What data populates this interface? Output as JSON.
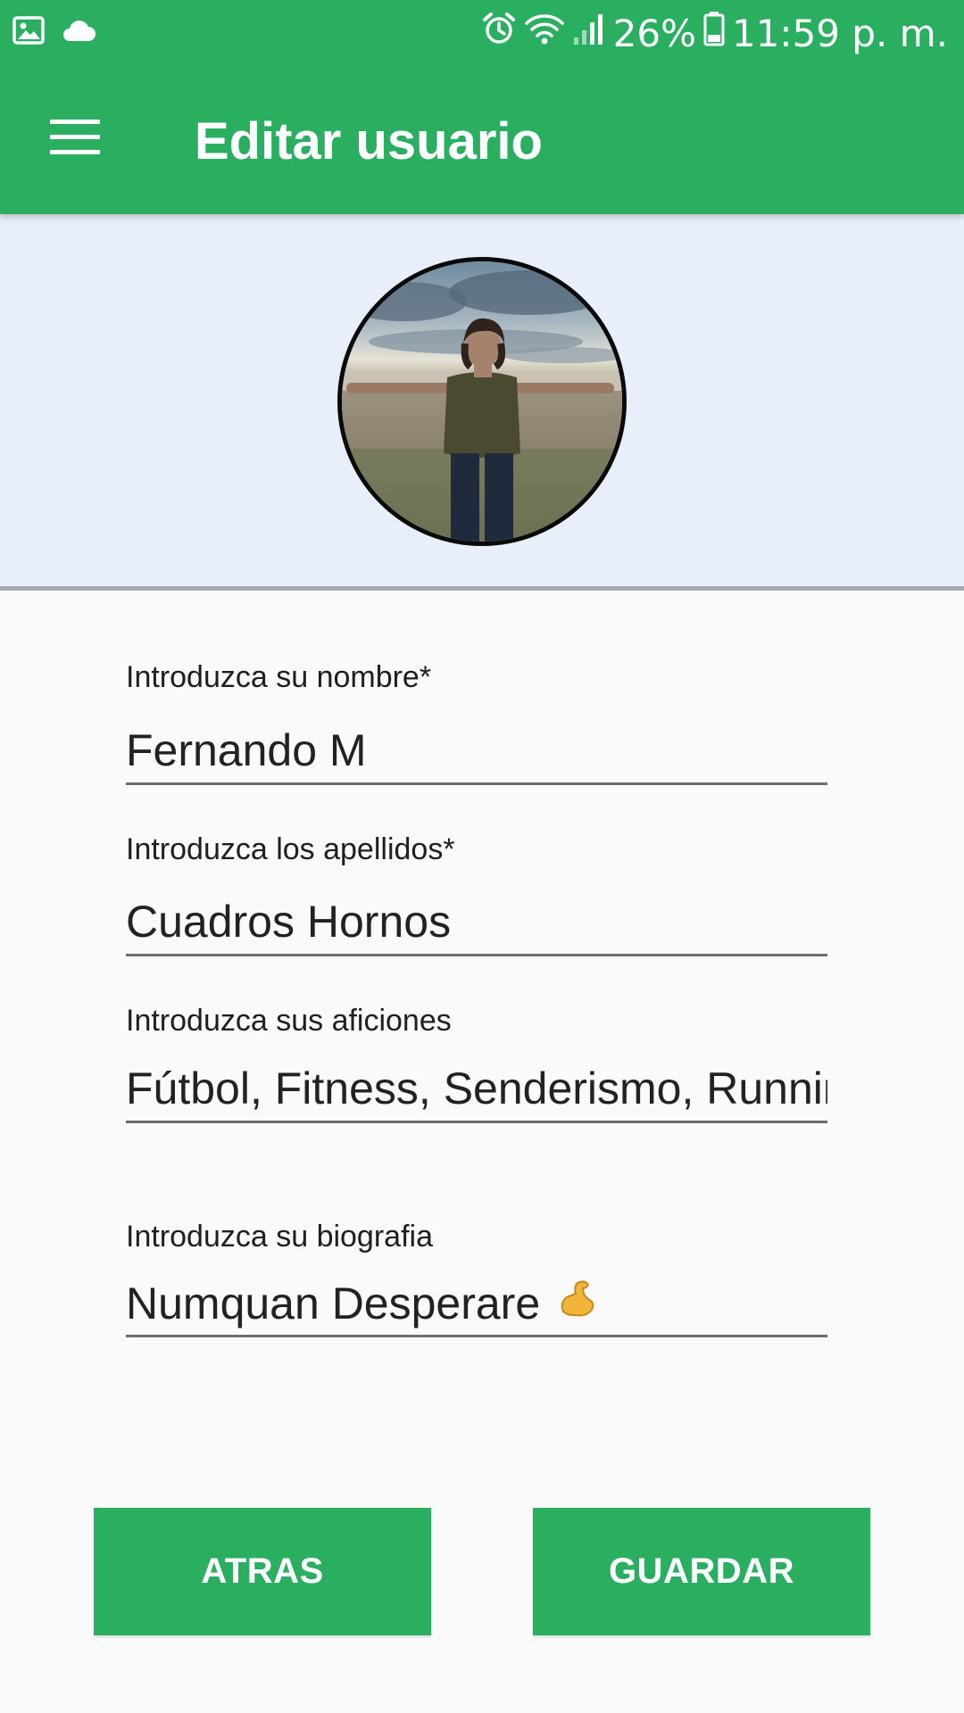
{
  "status_bar": {
    "battery_percent": "26%",
    "time": "11:59 p. m.",
    "icons": [
      "gallery-icon",
      "cloud-icon",
      "alarm-icon",
      "wifi-icon",
      "signal-icon",
      "battery-icon"
    ]
  },
  "app_bar": {
    "title": "Editar usuario",
    "menu_icon": "hamburger-menu-icon"
  },
  "profile": {
    "avatar_icon": "profile-photo"
  },
  "form": {
    "nombre": {
      "label": "Introduzca su nombre*",
      "value": "Fernando M"
    },
    "apellidos": {
      "label": "Introduzca los apellidos*",
      "value": "Cuadros Hornos"
    },
    "aficiones": {
      "label": "Introduzca sus aficiones",
      "value": "Fútbol, Fitness, Senderismo, Running"
    },
    "biografia": {
      "label": "Introduzca su biografia",
      "value": "Numquan Desperare",
      "emoji_icon": "flexed-biceps-icon"
    }
  },
  "buttons": {
    "back_label": "ATRAS",
    "save_label": "GUARDAR"
  },
  "colors": {
    "primary_green": "#2aaf61",
    "header_background": "#e9eefb",
    "page_background": "#fafafa"
  }
}
